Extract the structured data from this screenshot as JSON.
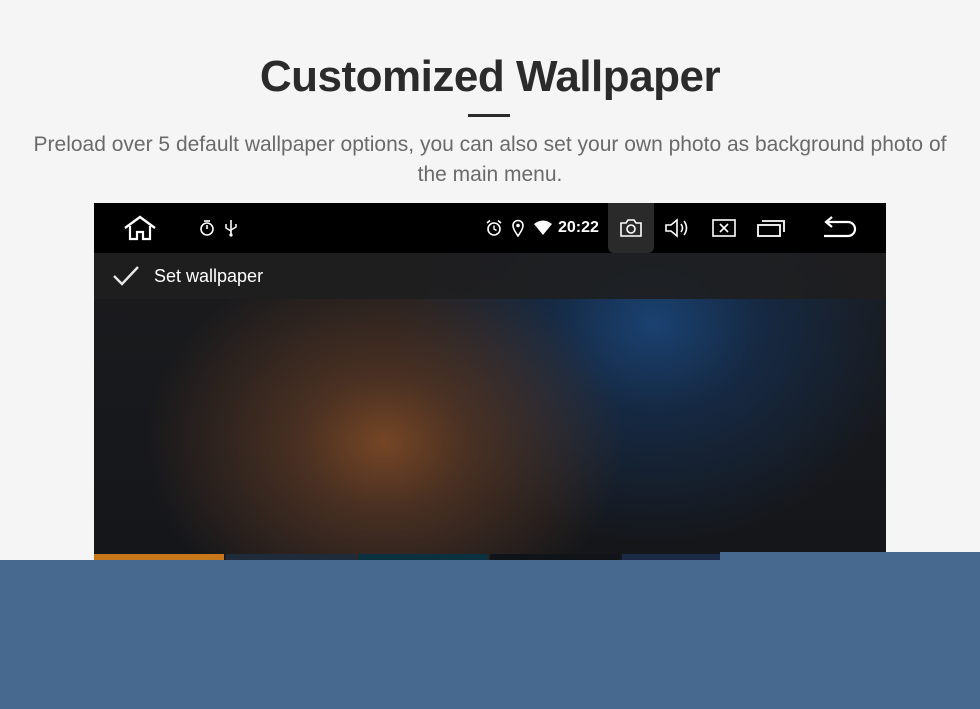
{
  "header": {
    "title": "Customized Wallpaper",
    "subtitle": "Preload over 5 default wallpaper options, you can also set your own photo as background photo of the main menu."
  },
  "screen": {
    "status_bar": {
      "time": "20:22",
      "icons": [
        "home-icon",
        "timer-icon",
        "usb-icon",
        "alarm-icon",
        "location-icon",
        "wifi-icon",
        "camera-icon",
        "volume-icon",
        "close-window-icon",
        "recent-apps-icon",
        "back-icon"
      ]
    },
    "action_bar": {
      "set_wallpaper_label": "Set wallpaper"
    },
    "thumbnail_colors": [
      "#c7781a",
      "#1d2b3a",
      "#0b3140",
      "#101318",
      "#1b2a44",
      "#6fa4c8"
    ]
  },
  "colors": {
    "overlay": "#48698f",
    "status_bar": "#000000"
  }
}
